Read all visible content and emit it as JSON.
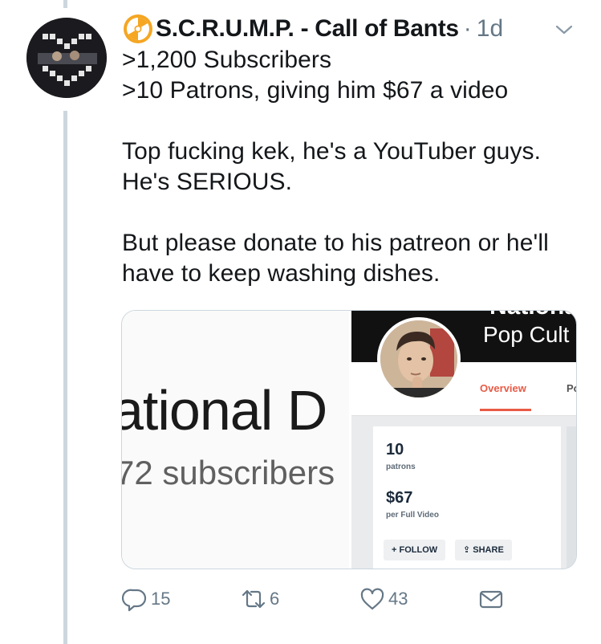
{
  "tweet": {
    "display_name": "S.C.R.U.M.P. - Call of Bants",
    "separator": "·",
    "timestamp": "1d",
    "icons": {
      "name_emoji": "radiation-icon",
      "caret": "chevron-down-icon"
    },
    "lines": [
      ">1,200 Subscribers",
      ">10 Patrons, giving him $67 a video",
      "",
      "Top fucking kek, he's a YouTuber guys.",
      "He's SERIOUS.",
      "",
      "But please donate to his patreon or he'll",
      "have to keep washing dishes."
    ]
  },
  "media": {
    "youtube": {
      "channel_name_fragment": "ational D",
      "subscribers_fragment": "72 subscribers"
    },
    "patreon": {
      "banner_title": "Pop Cult",
      "tab_overview": "Overview",
      "tab_next": "Po",
      "patrons_count": "10",
      "patrons_label": "patrons",
      "amount": "$67",
      "amount_label": "per Full Video",
      "follow_label": "+ FOLLOW",
      "share_label": "SHARE"
    }
  },
  "actions": {
    "replies": "15",
    "retweets": "6",
    "likes": "43",
    "icons": [
      "reply-icon",
      "retweet-icon",
      "like-icon",
      "direct-message-icon"
    ]
  },
  "colors": {
    "text": "#14171a",
    "muted": "#657786",
    "thread_line": "#ccd6dd",
    "radiation_fill": "#f5a623",
    "patreon_accent": "#e85b46"
  }
}
